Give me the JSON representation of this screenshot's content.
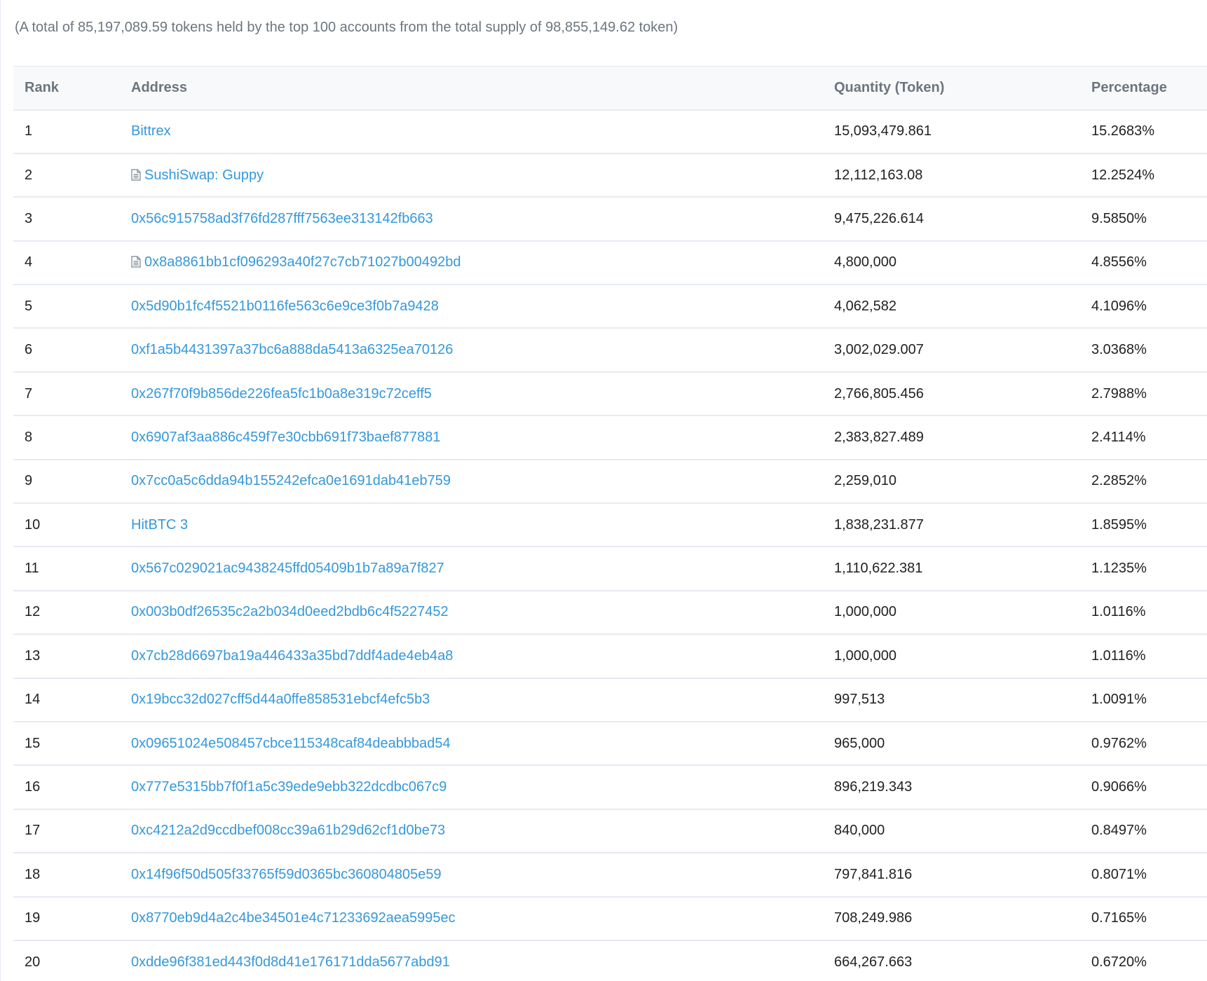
{
  "summary": "(A total of 85,197,089.59 tokens held by the top 100 accounts from the total supply of 98,855,149.62 token)",
  "table": {
    "headers": {
      "rank": "Rank",
      "address": "Address",
      "quantity": "Quantity (Token)",
      "percentage": "Percentage"
    },
    "rows": [
      {
        "rank": "1",
        "address": "Bittrex",
        "contract": false,
        "quantity": "15,093,479.861",
        "percentage": "15.2683%"
      },
      {
        "rank": "2",
        "address": "SushiSwap: Guppy",
        "contract": true,
        "quantity": "12,112,163.08",
        "percentage": "12.2524%"
      },
      {
        "rank": "3",
        "address": "0x56c915758ad3f76fd287fff7563ee313142fb663",
        "contract": false,
        "quantity": "9,475,226.614",
        "percentage": "9.5850%"
      },
      {
        "rank": "4",
        "address": "0x8a8861bb1cf096293a40f27c7cb71027b00492bd",
        "contract": true,
        "quantity": "4,800,000",
        "percentage": "4.8556%"
      },
      {
        "rank": "5",
        "address": "0x5d90b1fc4f5521b0116fe563c6e9ce3f0b7a9428",
        "contract": false,
        "quantity": "4,062,582",
        "percentage": "4.1096%"
      },
      {
        "rank": "6",
        "address": "0xf1a5b4431397a37bc6a888da5413a6325ea70126",
        "contract": false,
        "quantity": "3,002,029.007",
        "percentage": "3.0368%"
      },
      {
        "rank": "7",
        "address": "0x267f70f9b856de226fea5fc1b0a8e319c72ceff5",
        "contract": false,
        "quantity": "2,766,805.456",
        "percentage": "2.7988%"
      },
      {
        "rank": "8",
        "address": "0x6907af3aa886c459f7e30cbb691f73baef877881",
        "contract": false,
        "quantity": "2,383,827.489",
        "percentage": "2.4114%"
      },
      {
        "rank": "9",
        "address": "0x7cc0a5c6dda94b155242efca0e1691dab41eb759",
        "contract": false,
        "quantity": "2,259,010",
        "percentage": "2.2852%"
      },
      {
        "rank": "10",
        "address": "HitBTC 3",
        "contract": false,
        "quantity": "1,838,231.877",
        "percentage": "1.8595%"
      },
      {
        "rank": "11",
        "address": "0x567c029021ac9438245ffd05409b1b7a89a7f827",
        "contract": false,
        "quantity": "1,110,622.381",
        "percentage": "1.1235%"
      },
      {
        "rank": "12",
        "address": "0x003b0df26535c2a2b034d0eed2bdb6c4f5227452",
        "contract": false,
        "quantity": "1,000,000",
        "percentage": "1.0116%"
      },
      {
        "rank": "13",
        "address": "0x7cb28d6697ba19a446433a35bd7ddf4ade4eb4a8",
        "contract": false,
        "quantity": "1,000,000",
        "percentage": "1.0116%"
      },
      {
        "rank": "14",
        "address": "0x19bcc32d027cff5d44a0ffe858531ebcf4efc5b3",
        "contract": false,
        "quantity": "997,513",
        "percentage": "1.0091%"
      },
      {
        "rank": "15",
        "address": "0x09651024e508457cbce115348caf84deabbbad54",
        "contract": false,
        "quantity": "965,000",
        "percentage": "0.9762%"
      },
      {
        "rank": "16",
        "address": "0x777e5315bb7f0f1a5c39ede9ebb322dcdbc067c9",
        "contract": false,
        "quantity": "896,219.343",
        "percentage": "0.9066%"
      },
      {
        "rank": "17",
        "address": "0xc4212a2d9ccdbef008cc39a61b29d62cf1d0be73",
        "contract": false,
        "quantity": "840,000",
        "percentage": "0.8497%"
      },
      {
        "rank": "18",
        "address": "0x14f96f50d505f33765f59d0365bc360804805e59",
        "contract": false,
        "quantity": "797,841.816",
        "percentage": "0.8071%"
      },
      {
        "rank": "19",
        "address": "0x8770eb9d4a2c4be34501e4c71233692aea5995ec",
        "contract": false,
        "quantity": "708,249.986",
        "percentage": "0.7165%"
      },
      {
        "rank": "20",
        "address": "0xdde96f381ed443f0d8d41e176171dda5677abd91",
        "contract": false,
        "quantity": "664,267.663",
        "percentage": "0.6720%"
      }
    ]
  },
  "colors": {
    "link": "#3498db",
    "header_bg": "#f8f9fa",
    "border": "#e7eaf3",
    "muted_text": "#6c757e"
  },
  "icons": {
    "contract": "contract-document-icon"
  }
}
